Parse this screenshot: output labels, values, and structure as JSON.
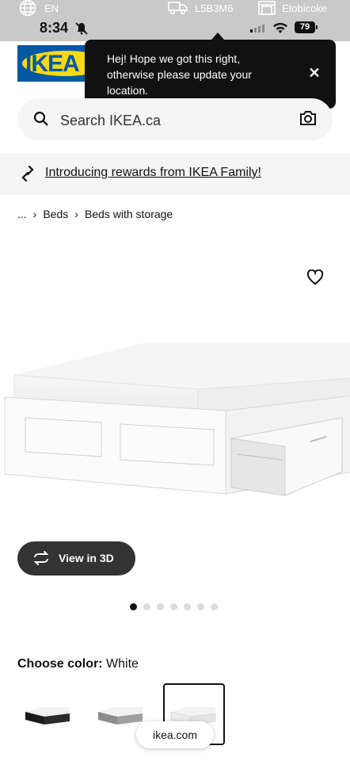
{
  "topbar": {
    "language": "EN",
    "postal_code": "L5B3M6",
    "store": "Etobicoke"
  },
  "status_bar": {
    "time": "8:34",
    "battery": "79"
  },
  "logo": {
    "text": "IKEA"
  },
  "location_popup": {
    "message": "Hej! Hope we got this right, otherwise please update your location."
  },
  "search": {
    "placeholder": "Search IKEA.ca"
  },
  "promo_banner": {
    "text": "Introducing rewards from IKEA Family!"
  },
  "breadcrumb": {
    "items": [
      "...",
      "Beds",
      "Beds with storage"
    ]
  },
  "product": {
    "image_alt": "BRIMNES bed frame with storage, white",
    "view_3d_label": "View in 3D",
    "image_count": 7,
    "active_image_index": 0
  },
  "color_picker": {
    "label": "Choose color:",
    "selected": "White",
    "options": [
      "black",
      "grey",
      "white"
    ]
  },
  "browser": {
    "url": "ikea.com"
  },
  "colors": {
    "ikea_blue": "#0058a3",
    "ikea_yellow": "#fbd914",
    "popup_bg": "#111111"
  }
}
